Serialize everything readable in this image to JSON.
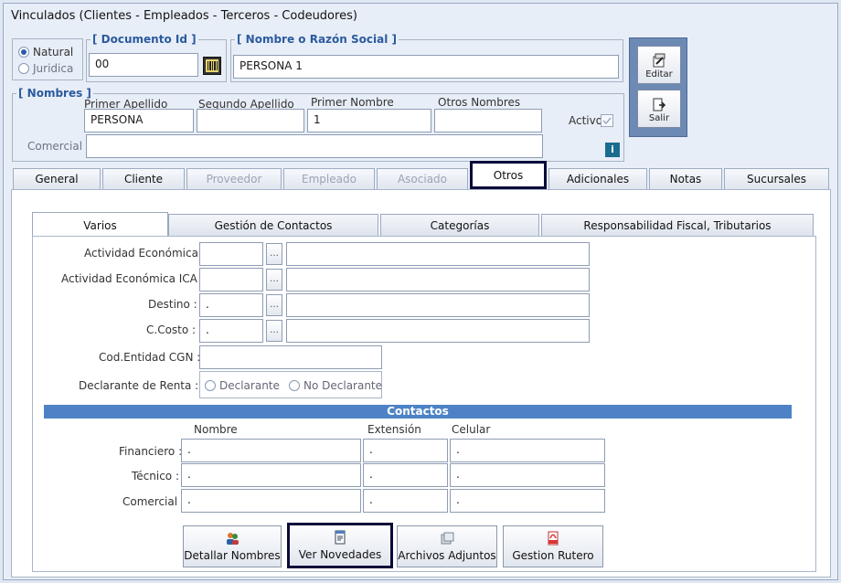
{
  "window": {
    "title": "Vinculados    (Clientes - Empleados - Terceros - Codeudores)"
  },
  "person_type": {
    "options": [
      "Natural",
      "Juridica"
    ],
    "selected": "Natural"
  },
  "documento": {
    "legend": "[ Documento Id ]",
    "value": "00"
  },
  "nombre_razon": {
    "legend": "[ Nombre o Razón Social ]",
    "value": "PERSONA 1"
  },
  "nombres": {
    "legend": "[ Nombres ]",
    "primer_apellido_label": "Primer Apellido",
    "segundo_apellido_label": "Segundo Apellido",
    "primer_nombre_label": "Primer Nombre",
    "otros_nombres_label": "Otros Nombres",
    "primer_apellido": "PERSONA",
    "segundo_apellido": "",
    "primer_nombre": "1",
    "otros_nombres": "",
    "activo_label": "Activo :",
    "comercial_label": "Comercial :",
    "comercial": ""
  },
  "side_buttons": {
    "editar": "Editar",
    "salir": "Salir"
  },
  "tabs": [
    "General",
    "Cliente",
    "Proveedor",
    "Empleado",
    "Asociado",
    "Otros",
    "Adicionales",
    "Notas",
    "Sucursales"
  ],
  "subtabs": [
    "Varios",
    "Gestión de Contactos",
    "Categorías",
    "Responsabilidad Fiscal, Tributarios"
  ],
  "varios": {
    "actividad_economica_label": "Actividad Económica :",
    "actividad_economica_ica_label": "Actividad Económica ICA :",
    "destino_label": "Destino :",
    "destino_code": ".",
    "ccosto_label": "C.Costo :",
    "ccosto_code": ".",
    "cod_entidad_label": "Cod.Entidad CGN :",
    "declarante_label": "Declarante de Renta :",
    "declarante_opt1": "Declarante",
    "declarante_opt2": "No Declarante"
  },
  "contactos": {
    "title": "Contactos",
    "col_nombre": "Nombre",
    "col_extension": "Extensión",
    "col_celular": "Celular",
    "rows": [
      {
        "label": "Financiero :",
        "nombre": ".",
        "extension": ".",
        "celular": "."
      },
      {
        "label": "Técnico :",
        "nombre": ".",
        "extension": ".",
        "celular": "."
      },
      {
        "label": "Comercial :",
        "nombre": ".",
        "extension": ".",
        "celular": "."
      }
    ]
  },
  "bottom_buttons": [
    "Detallar Nombres",
    "Ver Novedades",
    "Archivos Adjuntos",
    "Gestion Rutero"
  ]
}
